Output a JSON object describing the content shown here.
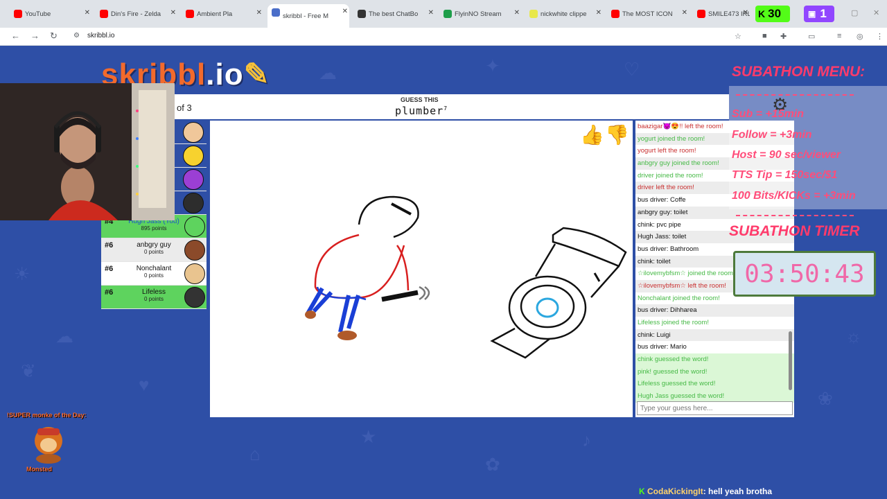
{
  "browser": {
    "tabs": [
      {
        "title": "YouTube",
        "color": "#ff0000"
      },
      {
        "title": "Din's Fire - Zelda",
        "color": "#ff0000"
      },
      {
        "title": "Ambient Pla",
        "color": "#ff0000"
      },
      {
        "title": "skribbl - Free M",
        "color": "#4a6ec9"
      },
      {
        "title": "The best ChatBo",
        "color": "#333333"
      },
      {
        "title": "FlyinNO Stream",
        "color": "#1e9e4a"
      },
      {
        "title": "nickwhite clippe",
        "color": "#e8e84a"
      },
      {
        "title": "The MOST ICON",
        "color": "#ff0000"
      },
      {
        "title": "SMILE473 IRL/ B",
        "color": "#ff0000"
      }
    ],
    "url": "skribbl.io",
    "viewers_green": "30",
    "viewers_purple": "1"
  },
  "game": {
    "logo_main": "skribbl",
    "logo_suffix": ".io",
    "round_text": "of 3",
    "guess_label": "GUESS THIS",
    "word": "plumber",
    "word_length": "7"
  },
  "players": [
    {
      "rank": "#4",
      "name": "Hugh Jass (You)",
      "points": "895 points",
      "you": true,
      "guessed": true,
      "color": "#5ed35e"
    },
    {
      "rank": "#6",
      "name": "anbgry guy",
      "points": "0 points",
      "color": "#8b4a2a"
    },
    {
      "rank": "#6",
      "name": "Nonchalant",
      "points": "0 points",
      "color": "#e9c48f"
    },
    {
      "rank": "#6",
      "name": "Lifeless",
      "points": "0 points",
      "guessed": true,
      "color": "#333333"
    }
  ],
  "chat": {
    "messages": [
      {
        "text": "baazigar😈😍!! left the room!",
        "type": "leave"
      },
      {
        "text": "yogurt joined the room!",
        "type": "join"
      },
      {
        "text": "yogurt left the room!",
        "type": "leave"
      },
      {
        "text": "anbgry guy joined the room!",
        "type": "join"
      },
      {
        "text": "driver joined the room!",
        "type": "join"
      },
      {
        "text": "driver left the room!",
        "type": "leave"
      },
      {
        "text": "bus driver: Coffe",
        "type": "msg"
      },
      {
        "text": "anbgry guy: toilet",
        "type": "msg"
      },
      {
        "text": "chink: pvc pipe",
        "type": "msg"
      },
      {
        "text": "Hugh Jass: toilet",
        "type": "msg"
      },
      {
        "text": "bus driver: Bathroom",
        "type": "msg"
      },
      {
        "text": "chink: toilet",
        "type": "msg"
      },
      {
        "text": "☆ilovemybfsm☆ joined the room!",
        "type": "join"
      },
      {
        "text": "☆ilovemybfsm☆ left the room!",
        "type": "leave"
      },
      {
        "text": "Nonchalant joined the room!",
        "type": "join"
      },
      {
        "text": "bus driver: Dihharea",
        "type": "msg"
      },
      {
        "text": "Lifeless joined the room!",
        "type": "join"
      },
      {
        "text": "chink: Luigi",
        "type": "msg"
      },
      {
        "text": "bus driver: Mario",
        "type": "msg"
      },
      {
        "text": "chink guessed the word!",
        "type": "correct"
      },
      {
        "text": "pink! guessed the word!",
        "type": "correct"
      },
      {
        "text": "Lifeless guessed the word!",
        "type": "correct"
      },
      {
        "text": "Hugh Jass guessed the word!",
        "type": "correct"
      }
    ],
    "input_placeholder": "Type your guess here..."
  },
  "overlay": {
    "subathon_menu_title": "SUBATHON MENU:",
    "items": [
      "Sub = +15min",
      "Follow = +3min",
      "Host = 90 sec/viewer",
      "TTS Tip = 150sec/$1",
      "100 Bits/KICKs = +3min"
    ],
    "timer_title": "SUBATHON TIMER",
    "timer": "03:50:43",
    "monke_title": "!SUPER monke of the Day:",
    "monke_name": "Monsted"
  },
  "stream_chat": {
    "user": "CodaKickingIt",
    "message": ": hell yeah brotha"
  }
}
